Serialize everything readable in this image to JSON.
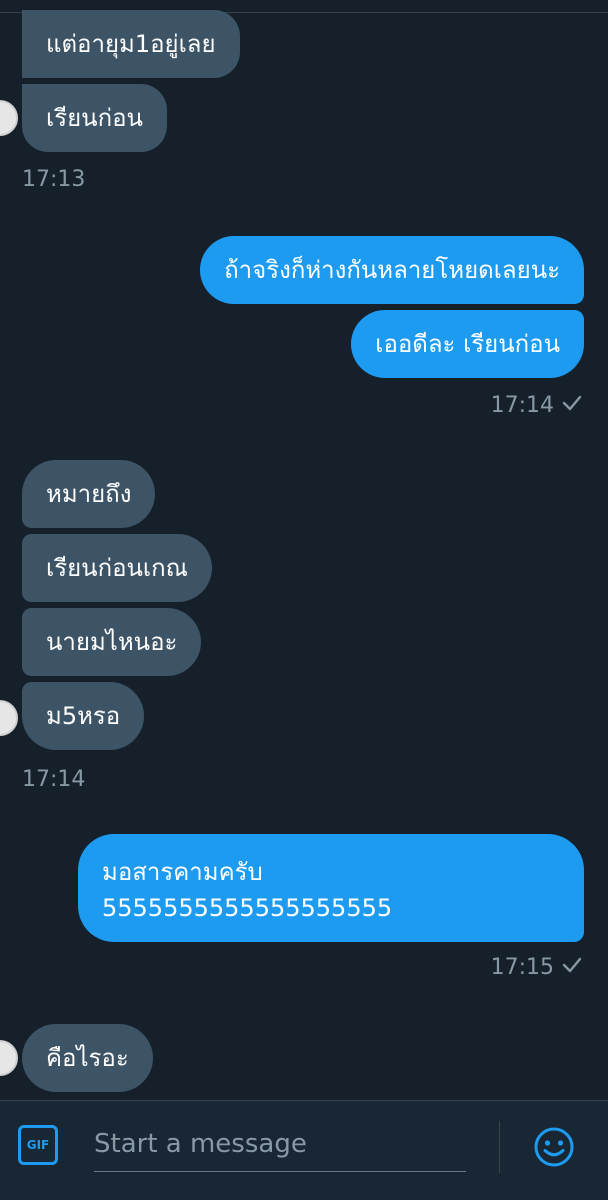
{
  "conversation": {
    "messages": [
      {
        "id": "m1",
        "direction": "in",
        "text": "แต่อายุม1อยู่เลย"
      },
      {
        "id": "m2",
        "direction": "in",
        "text": "เรียนก่อน"
      },
      {
        "id": "m3",
        "direction": "out",
        "text": "ถ้าจริงก็ห่างกันหลายโหยดเลยนะ"
      },
      {
        "id": "m4",
        "direction": "out",
        "text": "เออดีละ เรียนก่อน"
      },
      {
        "id": "m5",
        "direction": "in",
        "text": "หมายถึง"
      },
      {
        "id": "m6",
        "direction": "in",
        "text": "เรียนก่อนเกณ"
      },
      {
        "id": "m7",
        "direction": "in",
        "text": "นายมไหนอะ"
      },
      {
        "id": "m8",
        "direction": "in",
        "text": "ม5หรอ"
      },
      {
        "id": "m9",
        "direction": "out",
        "text_line1": "มอสารคามครับ",
        "text_line2": "5555555555555555555"
      },
      {
        "id": "m10",
        "direction": "in",
        "text": "คือไรอะ"
      }
    ],
    "timestamps": {
      "t1": "17:13",
      "t2": "17:14",
      "t3": "17:14",
      "t4": "17:15"
    }
  },
  "composer": {
    "gif_label": "GIF",
    "placeholder": "Start a message"
  },
  "icons": {
    "check": "check-icon",
    "emoji": "smiley-icon",
    "gif": "gif-icon"
  },
  "colors": {
    "background": "#15202b",
    "incoming_bubble": "#3d5466",
    "outgoing_bubble": "#1d9bf0",
    "accent": "#1d9bf0",
    "timestamp": "#8899a6"
  }
}
